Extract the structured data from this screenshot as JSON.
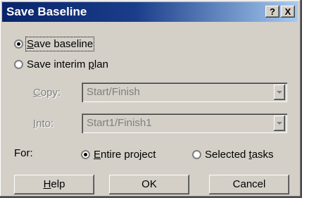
{
  "dialog": {
    "title": "Save Baseline",
    "help_icon_label": "?",
    "close_icon_label": "X"
  },
  "mode": {
    "save_baseline": {
      "prefix": "",
      "accel": "S",
      "rest": "ave baseline",
      "checked": true
    },
    "save_interim": {
      "prefix": "Save interim ",
      "accel": "p",
      "rest": "lan",
      "checked": false
    }
  },
  "copy": {
    "accel": "C",
    "rest": "opy:",
    "value": "Start/Finish"
  },
  "into": {
    "accel": "I",
    "rest": "nto:",
    "value": "Start1/Finish1"
  },
  "for": {
    "label": "For:",
    "entire": {
      "accel": "E",
      "rest": "ntire project",
      "checked": true
    },
    "selected": {
      "prefix": "Selected ",
      "accel": "t",
      "rest": "asks",
      "checked": false
    }
  },
  "buttons": {
    "help": {
      "accel": "H",
      "rest": "elp"
    },
    "ok": "OK",
    "cancel": "Cancel"
  }
}
